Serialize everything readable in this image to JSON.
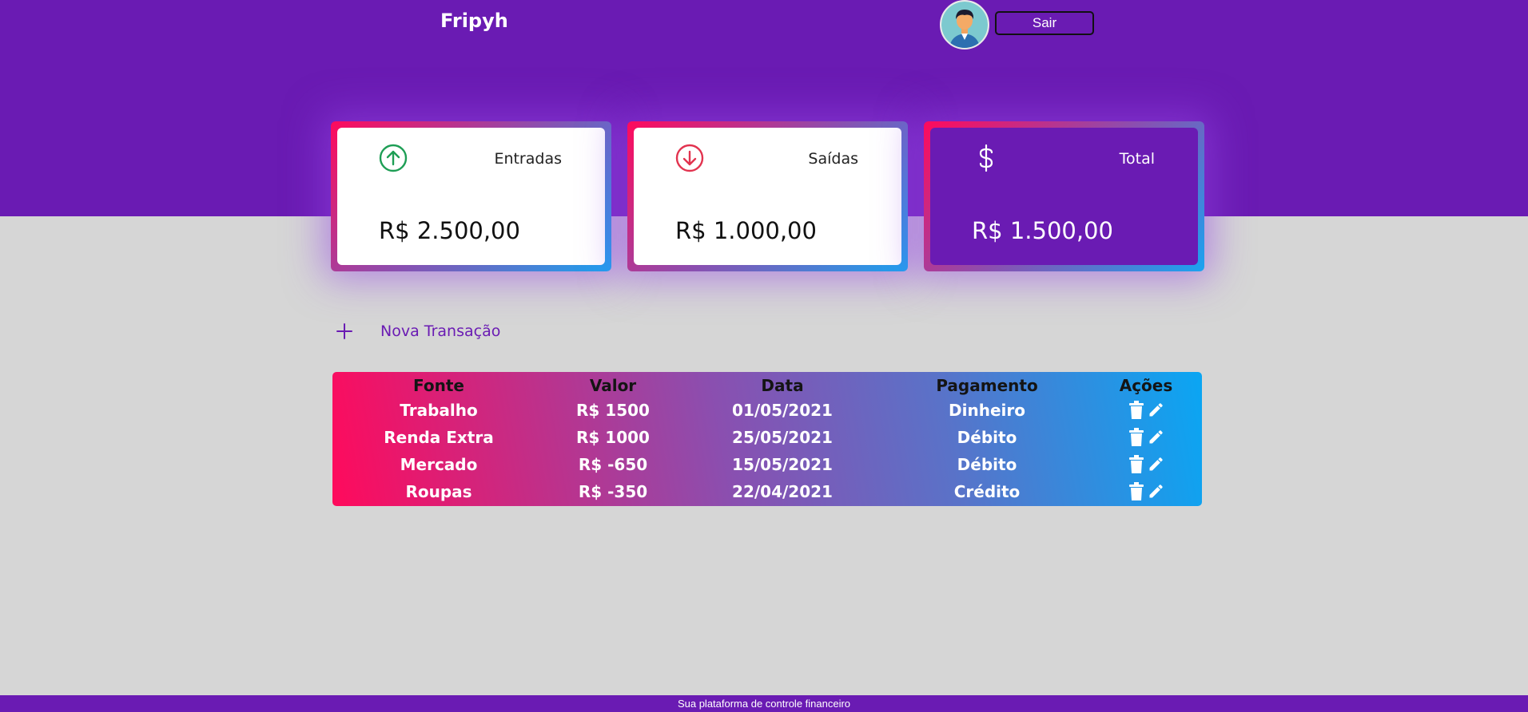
{
  "header": {
    "brand": "Fripyh",
    "logout_label": "Sair",
    "bg_color": "#6a1bb3"
  },
  "cards": [
    {
      "title": "Entradas",
      "value": "R$ 2.500,00",
      "icon": "arrow-up-circle-icon",
      "icon_color": "#1e9e55"
    },
    {
      "title": "Saídas",
      "value": "R$ 1.000,00",
      "icon": "arrow-down-circle-icon",
      "icon_color": "#e2334f"
    },
    {
      "title": "Total",
      "value": "R$ 1.500,00",
      "icon": "dollar-icon",
      "icon_color": "#ffffff"
    }
  ],
  "new_transaction": {
    "label": "Nova Transação",
    "icon": "plus-icon"
  },
  "table": {
    "columns": [
      "Fonte",
      "Valor",
      "Data",
      "Pagamento",
      "Ações"
    ],
    "rows": [
      {
        "fonte": "Trabalho",
        "valor": "R$ 1500",
        "data": "01/05/2021",
        "pagamento": "Dinheiro"
      },
      {
        "fonte": "Renda Extra",
        "valor": "R$ 1000",
        "data": "25/05/2021",
        "pagamento": "Débito"
      },
      {
        "fonte": "Mercado",
        "valor": "R$ -650",
        "data": "15/05/2021",
        "pagamento": "Débito"
      },
      {
        "fonte": "Roupas",
        "valor": "R$ -350",
        "data": "22/04/2021",
        "pagamento": "Crédito"
      }
    ],
    "row_actions": [
      "trash-icon",
      "pencil-icon"
    ]
  },
  "footer": {
    "text": "Sua plataforma de controle financeiro"
  }
}
